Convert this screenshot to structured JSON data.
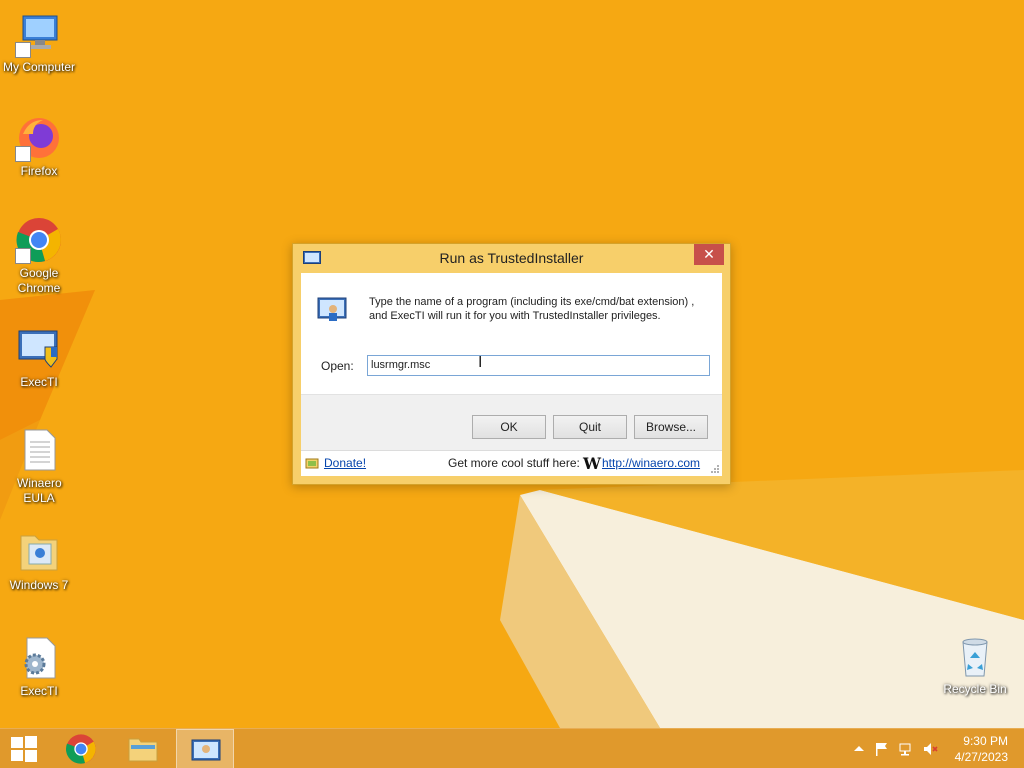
{
  "desktop": {
    "icons": [
      {
        "label": "My Computer",
        "icon": "computer-icon"
      },
      {
        "label": "Firefox",
        "icon": "firefox-icon"
      },
      {
        "label": "Google Chrome",
        "icon": "chrome-icon"
      },
      {
        "label": "ExecTI",
        "icon": "execti-shield-icon"
      },
      {
        "label": "Winaero EULA",
        "icon": "text-document-icon"
      },
      {
        "label": "Windows 7",
        "icon": "folder-icon"
      },
      {
        "label": "ExecTI",
        "icon": "settings-gear-icon"
      },
      {
        "label": "Recycle Bin",
        "icon": "recycle-bin-icon"
      }
    ]
  },
  "dialog": {
    "title": "Run as TrustedInstaller",
    "close_symbol": "✕",
    "info_text": "Type the name of a program (including its exe/cmd/bat extension) , and ExecTI will run it for you with TrustedInstaller privileges.",
    "open_label": "Open:",
    "open_value": "lusrmgr.msc",
    "buttons": {
      "ok": "OK",
      "quit": "Quit",
      "browse": "Browse..."
    },
    "footer": {
      "donate": "Donate!",
      "more": "Get more cool stuff here:",
      "logo_letter": "W",
      "link": "http://winaero.com"
    }
  },
  "taskbar": {
    "items": [
      "start-button",
      "chrome-icon",
      "file-explorer-icon",
      "execti-icon"
    ],
    "clock": {
      "time": "9:30 PM",
      "date": "4/27/2023"
    }
  },
  "colors": {
    "wallpaper": "#f5a511",
    "dialog_frame": "#f7cf6a",
    "close_button": "#c7504a",
    "link": "#0645ad"
  }
}
